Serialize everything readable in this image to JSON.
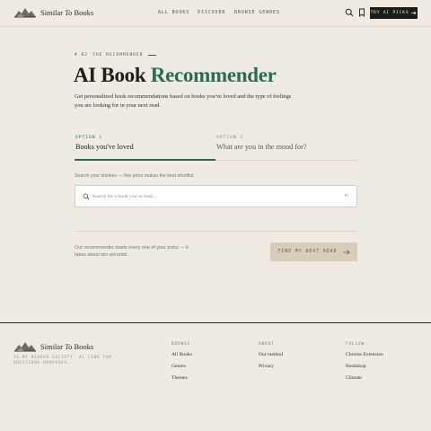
{
  "header": {
    "logo_prefix": "Similar ",
    "logo_italic": "To",
    "logo_suffix": " Books",
    "nav": [
      "ALL BOOKS",
      "DISCOVER",
      "BROWSE GENRES"
    ],
    "cta_label": "TRY AI PICKS",
    "icons": [
      "search-icon",
      "bookmark-icon",
      "arrow-right-icon"
    ]
  },
  "hero": {
    "eyebrow_number": "# 02",
    "eyebrow_label": "THE RECOMMENDER",
    "title_main": "AI Book",
    "title_accent": "Recommender",
    "subtitle": "Get personalized book recommendations based on books you've loved and the type of feelings you are looking for in your next read."
  },
  "tabs": [
    {
      "label": "OPTION 1",
      "text": "Books you've loved"
    },
    {
      "label": "OPTION 2",
      "text": "What are you in the mood for?"
    }
  ],
  "search": {
    "hint": "Search your shelves — five picks makes the best shortlist.",
    "placeholder": "Search for a book you've read...",
    "shortcut": "⌘/"
  },
  "submit": {
    "note": "Our recommender reads every one of your picks — it takes about ten seconds.",
    "button_label": "FIND MY NEXT READ"
  },
  "footer": {
    "tagline": "IS MY READER SOCIETY. AI LINE FOR QUESTIONS PURPOSES.",
    "columns": [
      {
        "heading": "BROWSE",
        "links": [
          "All Books",
          "Genres",
          "Themes"
        ]
      },
      {
        "heading": "ABOUT",
        "links": [
          "Our method",
          "Privacy"
        ]
      },
      {
        "heading": "FOLLOW",
        "links": [
          "Chrome Extension",
          "Bookshop",
          "Climate"
        ]
      }
    ]
  },
  "colors": {
    "background": "#efebe3",
    "accent_green": "#2c6a4d",
    "cta_dark": "#1b1b19",
    "submit_tan": "#d7cdb9"
  }
}
